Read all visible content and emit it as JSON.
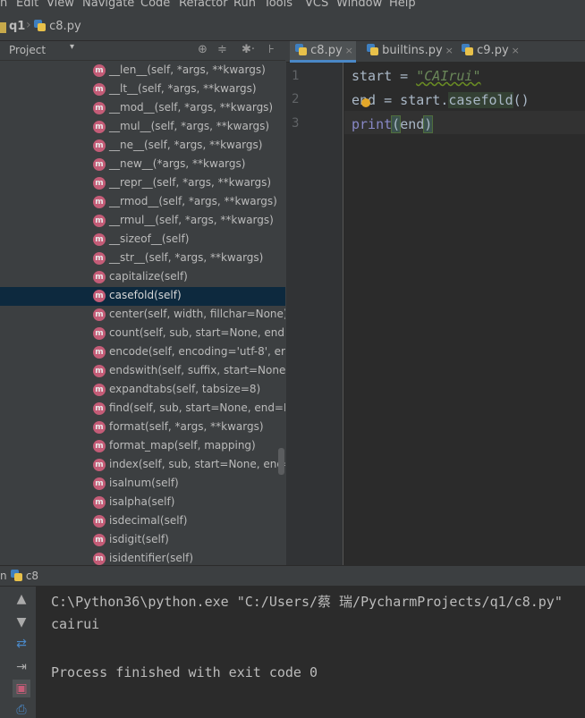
{
  "menu": [
    "n",
    "Edit",
    "View",
    "Navigate",
    "Code",
    "Refactor",
    "Run",
    "Tools",
    "VCS",
    "Window",
    "Help"
  ],
  "navbar": {
    "project": "q1",
    "file": "c8.py"
  },
  "project_panel": {
    "title": "Project",
    "dropdown": "▾",
    "tools": [
      "⊕",
      "≑",
      "✱·",
      "⊦"
    ],
    "items": [
      "__len__(self, *args, **kwargs)",
      "__lt__(self, *args, **kwargs)",
      "__mod__(self, *args, **kwargs)",
      "__mul__(self, *args, **kwargs)",
      "__ne__(self, *args, **kwargs)",
      "__new__(*args, **kwargs)",
      "__repr__(self, *args, **kwargs)",
      "__rmod__(self, *args, **kwargs)",
      "__rmul__(self, *args, **kwargs)",
      "__sizeof__(self)",
      "__str__(self, *args, **kwargs)",
      "capitalize(self)",
      "casefold(self)",
      "center(self, width, fillchar=None)",
      "count(self, sub, start=None, end=",
      "encode(self, encoding='utf-8', erro",
      "endswith(self, suffix, start=None, e",
      "expandtabs(self, tabsize=8)",
      "find(self, sub, start=None, end=N",
      "format(self, *args, **kwargs)",
      "format_map(self, mapping)",
      "index(self, sub, start=None, end=",
      "isalnum(self)",
      "isalpha(self)",
      "isdecimal(self)",
      "isdigit(self)",
      "isidentifier(self)"
    ],
    "method_badge": "m",
    "selected_index": 12
  },
  "tabs": [
    {
      "label": "c8.py",
      "active": true
    },
    {
      "label": "builtins.py",
      "active": false
    },
    {
      "label": "c9.py",
      "active": false
    }
  ],
  "tab_close": "×",
  "editor": {
    "line_numbers": [
      "1",
      "2",
      "3"
    ],
    "line1": {
      "var": "start = ",
      "str": "\"CAIrui\""
    },
    "line2": {
      "pre": "end = start.",
      "fn": "casefold",
      "post": "()"
    },
    "line3": {
      "kw": "print",
      "open": "(",
      "arg": "end",
      "close": ")"
    }
  },
  "run": {
    "label": "n",
    "config": "c8",
    "command": "C:\\Python36\\python.exe \"C:/Users/蔡 瑞/PycharmProjects/q1/c8.py\"",
    "output": "cairui",
    "finish": "Process finished with exit code 0",
    "tool_icons": [
      "▲",
      "▼",
      "⇄",
      "⇥",
      "▣",
      "⎙",
      "🗑"
    ]
  }
}
